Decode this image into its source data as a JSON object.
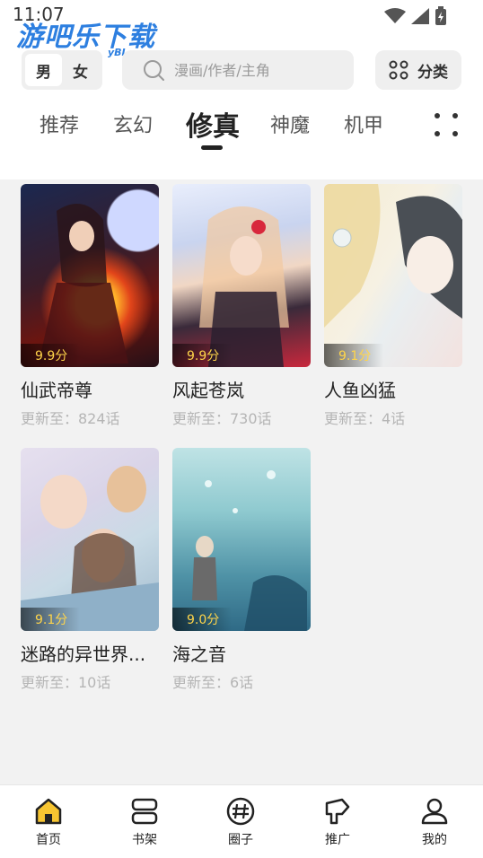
{
  "status_bar": {
    "time": "11:07"
  },
  "watermark": {
    "text": "游吧乐下载",
    "sub": "yBL.com"
  },
  "header": {
    "gender_male": "男",
    "gender_female": "女",
    "search_placeholder": "漫画/作者/主角",
    "category_label": "分类"
  },
  "tabs": [
    "推荐",
    "玄幻",
    "修真",
    "神魔",
    "机甲"
  ],
  "active_tab": "修真",
  "comics": [
    {
      "title": "仙武帝尊",
      "score": "9.9分",
      "update": "更新至：824话"
    },
    {
      "title": "风起苍岚",
      "score": "9.9分",
      "update": "更新至：730话"
    },
    {
      "title": "人鱼凶猛",
      "score": "9.1分",
      "update": "更新至：4话"
    },
    {
      "title": "迷路的异世界...",
      "score": "9.1分",
      "update": "更新至：10话"
    },
    {
      "title": "海之音",
      "score": "9.0分",
      "update": "更新至：6话"
    }
  ],
  "bottom_nav": [
    {
      "label": "首页",
      "icon": "home-icon"
    },
    {
      "label": "书架",
      "icon": "bookshelf-icon"
    },
    {
      "label": "圈子",
      "icon": "community-icon"
    },
    {
      "label": "推广",
      "icon": "promote-icon"
    },
    {
      "label": "我的",
      "icon": "user-icon"
    }
  ],
  "colors": {
    "accent": "#f7c531",
    "score": "#ffd54a"
  }
}
